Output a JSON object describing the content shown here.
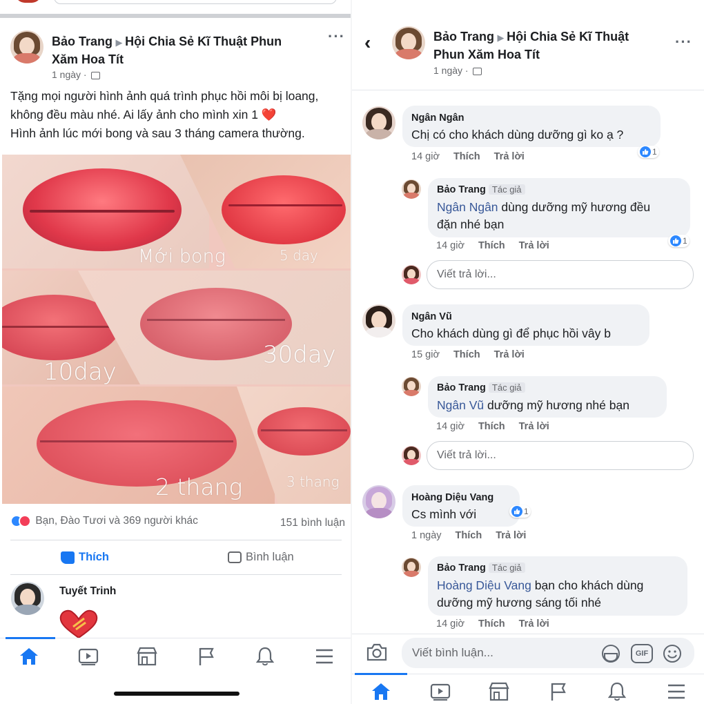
{
  "left": {
    "post": {
      "author": "Bảo Trang",
      "group": "Hội Chia Sẻ Kĩ Thuật Phun Xăm Hoa Tít",
      "group_line1": "Hội Chia Sẻ Kĩ Thuật Phun",
      "group_line2": "Xăm Hoa Tít",
      "time": "1 ngày ·",
      "text_line1": "Tặng mọi người hình ảnh quá trình phục hồi môi bị loang,",
      "text_line2": "không đều màu nhé. Ai lấy ảnh cho mình xin 1",
      "text_line3": "Hình ảnh lúc mới bong và sau 3 tháng camera thường.",
      "photo_labels": {
        "moi_bong": "Mới bong",
        "day5": "5 day",
        "day10": "10day",
        "day30": "30day",
        "thang2": "2 thang",
        "thang3": "3 thang"
      },
      "reactions_text": "Bạn, Đào Tươi và 369 người khác",
      "comments_count": "151 bình luận",
      "like_label": "Thích",
      "comment_label": "Bình luận"
    },
    "first_comment": {
      "name": "Tuyết Trinh"
    },
    "nav": [
      "home-icon",
      "video-icon",
      "marketplace-icon",
      "pages-flag-icon",
      "bell-icon",
      "menu-icon"
    ]
  },
  "right": {
    "header": {
      "author": "Bảo Trang",
      "group_line1": "Hội Chia Sẻ Kĩ Thuật",
      "group_line2": "Phun Xăm Hoa Tít",
      "time": "1 ngày ·"
    },
    "comments": [
      {
        "name": "Ngân Ngân",
        "text": "Chị có cho khách dùng dưỡng gì ko ạ ?",
        "time": "14 giờ",
        "like": "Thích",
        "reply": "Trả lời",
        "likes": "1"
      },
      {
        "name": "Bảo Trang",
        "tag": "Tác giả",
        "mention": "Ngân Ngân",
        "text_a": "dùng dưỡng mỹ hương đều",
        "text_b": "đặn nhé bạn",
        "time": "14 giờ",
        "like": "Thích",
        "reply": "Trả lời",
        "likes": "1"
      },
      {
        "name": "Ngân Vũ",
        "text": "Cho khách dùng gì để phục hồi vây b",
        "time": "15 giờ",
        "like": "Thích",
        "reply": "Trả lời"
      },
      {
        "name": "Bảo Trang",
        "tag": "Tác giả",
        "mention": "Ngân Vũ",
        "text_a": "dưỡng mỹ hương nhé bạn",
        "time": "14 giờ",
        "like": "Thích",
        "reply": "Trả lời"
      },
      {
        "name": "Hoàng Diệu Vang",
        "text": "Cs mình với",
        "time": "1 ngày",
        "like": "Thích",
        "reply": "Trả lời",
        "likes": "1"
      },
      {
        "name": "Bảo Trang",
        "tag": "Tác giả",
        "mention": "Hoàng Diệu Vang",
        "text_a": "bạn cho khách dùng",
        "text_b": "dưỡng mỹ hương sáng tối nhé",
        "time": "14 giờ",
        "like": "Thích",
        "reply": "Trả lời"
      }
    ],
    "reply_placeholder": "Viết trả lời...",
    "comment_placeholder": "Viết bình luận...",
    "gif_label": "GIF",
    "nav": [
      "home-icon",
      "video-icon",
      "marketplace-icon",
      "pages-flag-icon",
      "bell-icon",
      "menu-icon"
    ]
  },
  "colors": {
    "accent": "#1877f2",
    "mention": "#385898",
    "bubble": "#f0f2f5",
    "like_blue": "#2d88ff",
    "love_red": "#f33e58"
  }
}
